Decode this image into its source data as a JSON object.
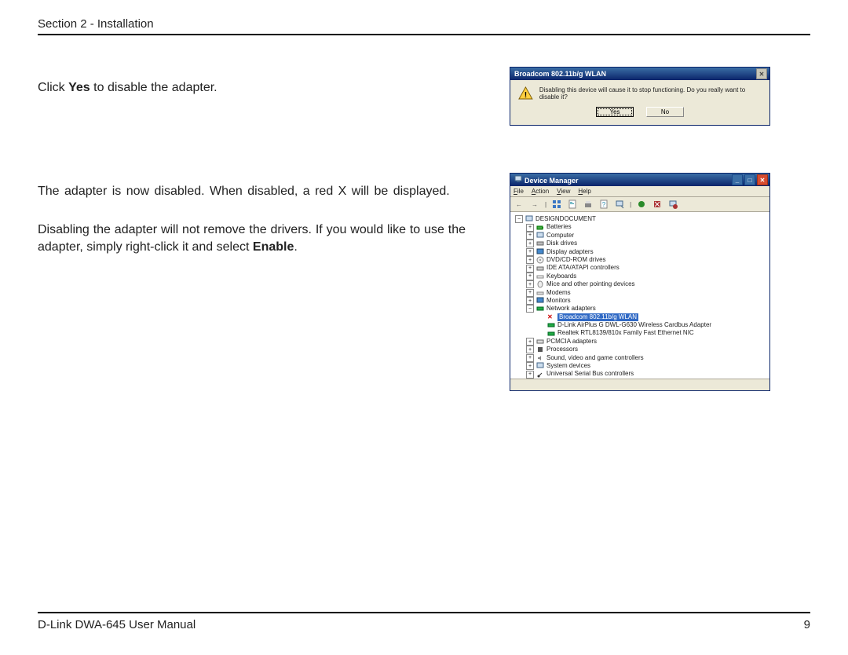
{
  "header": {
    "section": "Section 2 - Installation"
  },
  "body": {
    "line1_pre": "Click ",
    "line1_bold": "Yes",
    "line1_post": " to disable the adapter.",
    "line2": "The adapter is now disabled. When disabled, a red X will be displayed.",
    "line3_pre": "Disabling the adapter will not remove the drivers. If you would like to use the adapter, simply right-click it and select ",
    "line3_bold": "Enable",
    "line3_post": "."
  },
  "dialog": {
    "title": "Broadcom 802.11b/g WLAN",
    "message": "Disabling this device will cause it to stop functioning. Do you really want to disable it?",
    "yes": "Yes",
    "no": "No"
  },
  "dm": {
    "title": "Device Manager",
    "menu": {
      "file": "File",
      "action": "Action",
      "view": "View",
      "help": "Help"
    },
    "root": "DESIGNDOCUMENT",
    "items": {
      "batteries": "Batteries",
      "computer": "Computer",
      "disk": "Disk drives",
      "display": "Display adapters",
      "dvd": "DVD/CD-ROM drives",
      "ide": "IDE ATA/ATAPI controllers",
      "keyboards": "Keyboards",
      "mice": "Mice and other pointing devices",
      "modems": "Modems",
      "monitors": "Monitors",
      "network": "Network adapters",
      "na1": "Broadcom 802.11b/g WLAN",
      "na2": "D-Link AirPlus G DWL-G630 Wireless Cardbus Adapter",
      "na3": "Realtek RTL8139/810x Family Fast Ethernet NIC",
      "pcmcia": "PCMCIA adapters",
      "processors": "Processors",
      "sound": "Sound, video and game controllers",
      "sysdev": "System devices",
      "usb": "Universal Serial Bus controllers"
    }
  },
  "footer": {
    "manual": "D-Link DWA-645 User Manual",
    "page": "9"
  }
}
